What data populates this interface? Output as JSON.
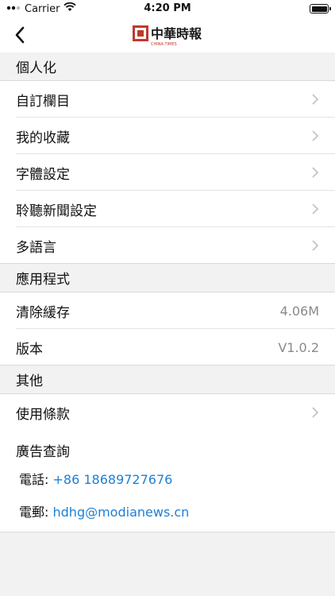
{
  "status_bar": {
    "carrier": "Carrier",
    "time": "4:20 PM"
  },
  "nav": {
    "logo_alt": "中華時報 CHINA TIMES"
  },
  "sections": [
    {
      "header": "個人化",
      "items": [
        {
          "label": "自訂欄目"
        },
        {
          "label": "我的收藏"
        },
        {
          "label": "字體設定"
        },
        {
          "label": "聆聽新聞設定"
        },
        {
          "label": "多語言"
        }
      ]
    },
    {
      "header": "應用程式",
      "items": [
        {
          "label": "清除緩存",
          "value": "4.06M"
        },
        {
          "label": "版本",
          "value": "V1.0.2"
        }
      ]
    },
    {
      "header": "其他",
      "items": [
        {
          "label": "使用條款"
        }
      ]
    }
  ],
  "contact": {
    "title": "廣告查詢",
    "phone_label": "電話:",
    "phone": "+86 18689727676",
    "email_label": "電郵:",
    "email": "hdhg@modianews.cn"
  },
  "colors": {
    "link": "#1e7fd6",
    "chevron": "#c4c4c8",
    "section_bg": "#f2f2f2"
  }
}
